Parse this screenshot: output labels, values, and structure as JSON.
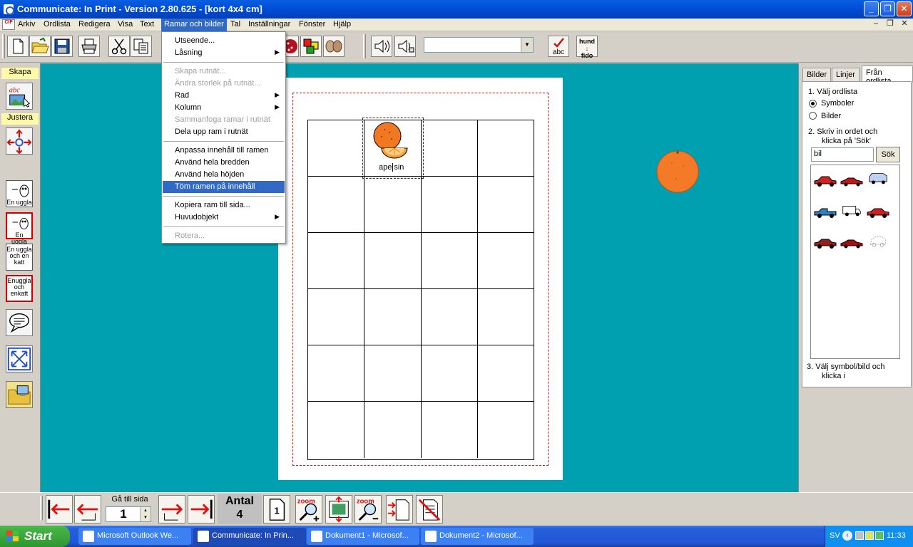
{
  "window": {
    "title": "Communicate: In Print - Version 2.80.625 - [kort 4x4 cm]"
  },
  "menubar": {
    "items": [
      "Arkiv",
      "Ordlista",
      "Redigera",
      "Visa",
      "Text",
      "Ramar och bilder",
      "Tal",
      "Inställningar",
      "Fönster",
      "Hjälp"
    ],
    "active": "Ramar och bilder"
  },
  "dropdown": {
    "items": [
      {
        "label": "Utseende...",
        "disabled": false,
        "submenu": false
      },
      {
        "label": "Låsning",
        "disabled": false,
        "submenu": true
      },
      {
        "label": "Skapa rutnät...",
        "disabled": true,
        "submenu": false
      },
      {
        "label": "Ändra storlek på rutnät...",
        "disabled": true,
        "submenu": false
      },
      {
        "label": "Rad",
        "disabled": false,
        "submenu": true
      },
      {
        "label": "Kolumn",
        "disabled": false,
        "submenu": true
      },
      {
        "label": "Sammanfoga ramar i rutnät",
        "disabled": true,
        "submenu": false
      },
      {
        "label": "Dela upp ram i rutnät",
        "disabled": false,
        "submenu": false
      },
      {
        "label": "Anpassa innehåll till ramen",
        "disabled": false,
        "submenu": false
      },
      {
        "label": "Använd hela bredden",
        "disabled": false,
        "submenu": false
      },
      {
        "label": "Använd hela höjden",
        "disabled": false,
        "submenu": false
      },
      {
        "label": "Töm ramen på innehåll",
        "disabled": false,
        "submenu": false,
        "highlighted": true
      },
      {
        "label": "Kopiera ram till sida...",
        "disabled": false,
        "submenu": false
      },
      {
        "label": "Huvudobjekt",
        "disabled": false,
        "submenu": true
      },
      {
        "label": "Rotera...",
        "disabled": true,
        "submenu": false
      }
    ]
  },
  "toolbar": {
    "right_buttons": {
      "abc": "abc",
      "hund": "hund",
      "fido": "fido"
    }
  },
  "leftpanel": {
    "skapa": "Skapa",
    "justera": "Justera",
    "cards": [
      "En uggla",
      "En uggla",
      "En uggla och en katt",
      "Enuggla och enkatt"
    ]
  },
  "document": {
    "cell_word_before": "ape",
    "cell_word_after": "sin"
  },
  "rightpanel": {
    "tabs": [
      "Bilder",
      "Linjer",
      "Från ordlista"
    ],
    "active_tab": "Från ordlista",
    "step1": "1. Välj ordlista",
    "radio_symboler": "Symboler",
    "radio_bilder": "Bilder",
    "step2_line1": "2. Skriv in ordet och",
    "step2_line2": "klicka på 'Sök'",
    "search_value": "bil",
    "search_button": "Sök",
    "step3_line1": "3. Välj symbol/bild och",
    "step3_line2": "klicka i"
  },
  "bottombar": {
    "goto_label": "Gå till sida",
    "goto_value": "1",
    "antal_label": "Antal",
    "antal_value": "4",
    "page_icon_label": "1",
    "zoom_text": "zoom"
  },
  "taskbar": {
    "start": "Start",
    "tasks": [
      "Microsoft Outlook We...",
      "Communicate: In Prin...",
      "Dokument1 - Microsof...",
      "Dokument2 - Microsof..."
    ],
    "active_task": "Communicate: In Prin...",
    "lang": "SV",
    "clock": "11:33"
  },
  "colors": {
    "workspace": "#00a0b0",
    "highlight": "#316ac5",
    "orange": "#f07820",
    "margin_dashes": "#d02020"
  }
}
